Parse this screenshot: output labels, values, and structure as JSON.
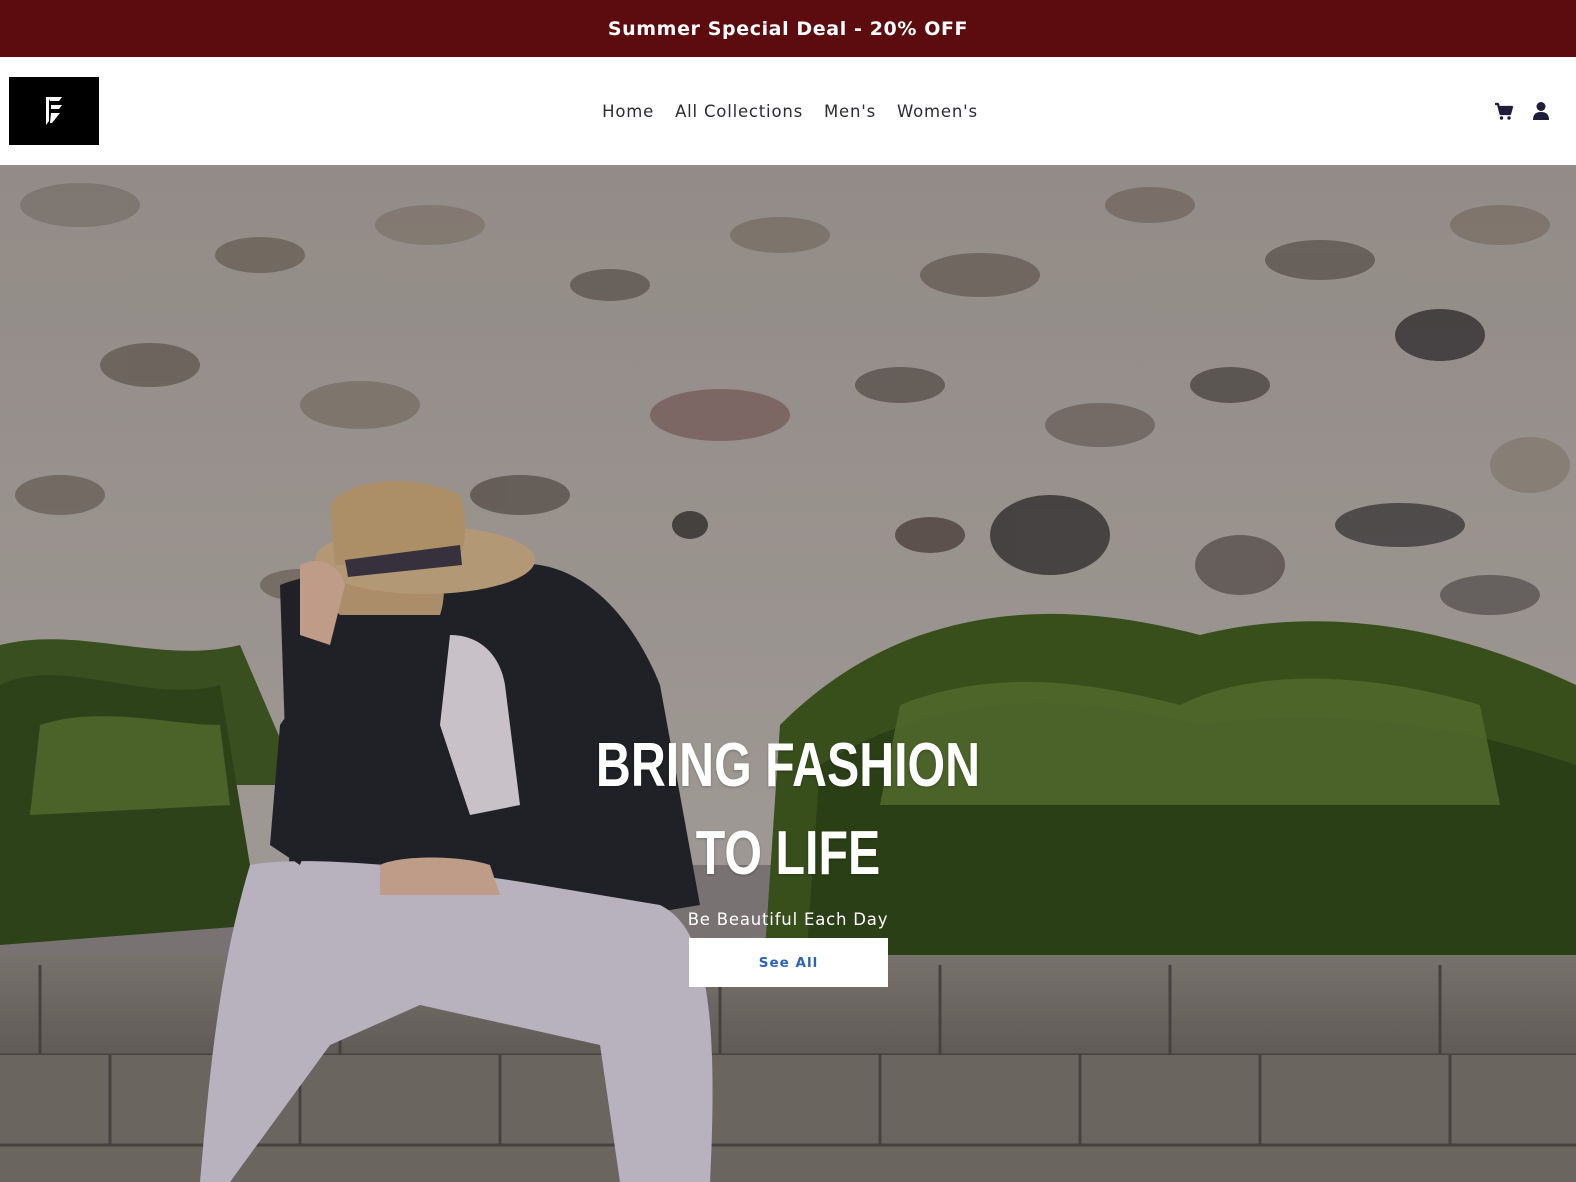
{
  "announcement": {
    "text": "Summer Special Deal - 20% OFF",
    "background": "#5c0b0e"
  },
  "header": {
    "logo_icon": "stylized-f-logo",
    "nav": [
      {
        "label": "Home"
      },
      {
        "label": "All Collections"
      },
      {
        "label": "Men's"
      },
      {
        "label": "Women's"
      }
    ],
    "icons": [
      "cart-icon",
      "account-icon"
    ]
  },
  "hero": {
    "title_line1": "BRING FASHION",
    "title_line2": "TO LIFE",
    "subtitle": "Be Beautiful Each Day",
    "button_label": "See All",
    "button_color": "#2a63b8"
  }
}
